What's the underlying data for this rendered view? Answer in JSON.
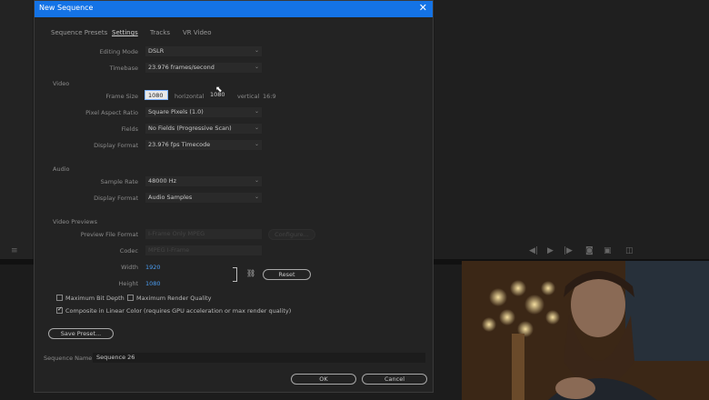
{
  "dialog": {
    "title": "New Sequence",
    "tabs": [
      "Sequence Presets",
      "Settings",
      "Tracks",
      "VR Video"
    ],
    "active_tab": 1
  },
  "settings": {
    "editing_mode": {
      "label": "Editing Mode",
      "value": "DSLR"
    },
    "timebase": {
      "label": "Timebase",
      "value": "23.976  frames/second"
    },
    "video": {
      "section": "Video",
      "frame_size": {
        "label": "Frame Size",
        "horizontal": "1080",
        "h_label": "horizontal",
        "vertical": "1080",
        "v_label": "vertical",
        "ratio": "16:9"
      },
      "pixel_aspect": {
        "label": "Pixel Aspect Ratio",
        "value": "Square Pixels (1.0)"
      },
      "fields": {
        "label": "Fields",
        "value": "No Fields (Progressive Scan)"
      },
      "display_format": {
        "label": "Display Format",
        "value": "23.976 fps Timecode"
      }
    },
    "audio": {
      "section": "Audio",
      "sample_rate": {
        "label": "Sample Rate",
        "value": "48000 Hz"
      },
      "display_format": {
        "label": "Display Format",
        "value": "Audio Samples"
      }
    },
    "previews": {
      "section": "Video Previews",
      "preview_file_format": {
        "label": "Preview File Format",
        "value": "I-Frame Only MPEG",
        "configure": "Configure..."
      },
      "codec": {
        "label": "Codec",
        "value": "MPEG I-Frame"
      },
      "width": {
        "label": "Width",
        "value": "1920"
      },
      "height": {
        "label": "Height",
        "value": "1080"
      },
      "reset": "Reset"
    },
    "max_bit_depth": "Maximum Bit Depth",
    "max_render_quality": "Maximum Render Quality",
    "composite_linear": "Composite in Linear Color (requires GPU acceleration or max render quality)"
  },
  "save_preset": "Save Preset...",
  "sequence_name": {
    "label": "Sequence Name:",
    "value": "Sequence 26"
  },
  "ok": "OK",
  "cancel": "Cancel"
}
